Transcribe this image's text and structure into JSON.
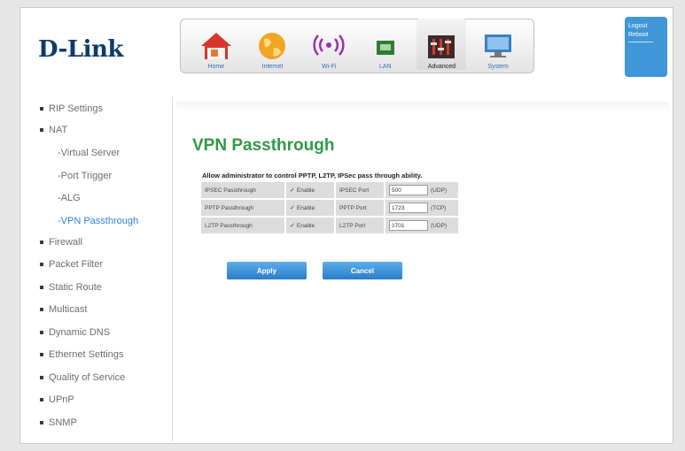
{
  "brand": {
    "logo": "D-Link"
  },
  "nav": [
    {
      "label": "Home",
      "icon": "home-icon"
    },
    {
      "label": "Internet",
      "icon": "globe-icon"
    },
    {
      "label": "Wi-Fi",
      "icon": "wifi-icon"
    },
    {
      "label": "LAN",
      "icon": "lan-icon"
    },
    {
      "label": "Advanced",
      "icon": "advanced-icon",
      "active": true
    },
    {
      "label": "System",
      "icon": "system-icon"
    }
  ],
  "account": {
    "logout": "Logout",
    "reboot": "Reboot"
  },
  "sidebar": {
    "items": [
      {
        "label": "RIP Settings"
      },
      {
        "label": "NAT"
      },
      {
        "label": "Firewall"
      },
      {
        "label": "Packet Filter"
      },
      {
        "label": "Static Route"
      },
      {
        "label": "Multicast"
      },
      {
        "label": "Dynamic DNS"
      },
      {
        "label": "Ethernet Settings"
      },
      {
        "label": "Quality of Service"
      },
      {
        "label": "UPnP"
      },
      {
        "label": "SNMP"
      }
    ],
    "nat_subitems": [
      {
        "label": "-Virtual Server"
      },
      {
        "label": "-Port Trigger"
      },
      {
        "label": "-ALG"
      },
      {
        "label": "-VPN Passthrough",
        "active": true
      }
    ]
  },
  "main": {
    "title": "VPN Passthrough",
    "description": "Allow administrator to control PPTP, L2TP, IPSec pass through ability.",
    "rows": [
      {
        "name": "IPSEC Passthrough",
        "enable_label": "Enable",
        "enabled": true,
        "port_label": "IPSEC Port",
        "port": "500",
        "protocol": "(UDP)"
      },
      {
        "name": "PPTP Passthrough",
        "enable_label": "Enable",
        "enabled": true,
        "port_label": "PPTP Port",
        "port": "1723",
        "protocol": "(TCP)"
      },
      {
        "name": "L2TP Passthrough",
        "enable_label": "Enable",
        "enabled": true,
        "port_label": "L2TP Port",
        "port": "1701",
        "protocol": "(UDP)"
      }
    ],
    "apply_label": "Apply",
    "cancel_label": "Cancel"
  },
  "colors": {
    "accent": "#2f9b45",
    "link": "#2f84d2",
    "button": "#3a8fd6",
    "brand": "#0c3c6e"
  }
}
